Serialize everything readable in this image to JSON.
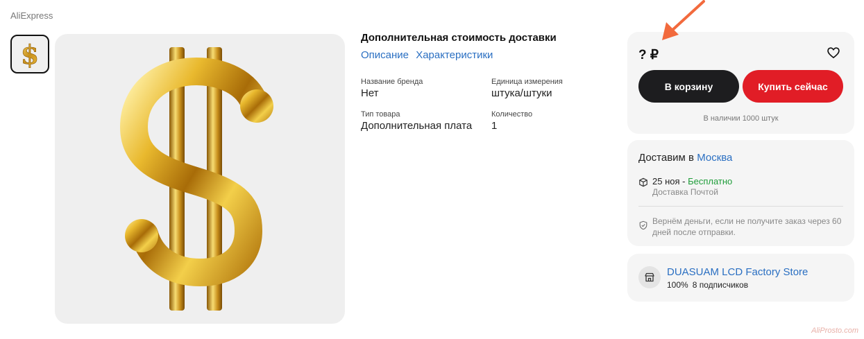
{
  "header": {
    "brand": "AliExpress"
  },
  "gallery": {
    "thumbnail_icon": "dollar-sign-icon",
    "main_image_icon": "gold-dollar-sign-icon"
  },
  "product": {
    "title": "Дополнительная стоимость доставки",
    "links": [
      "Описание",
      "Характеристики"
    ],
    "specs": [
      {
        "label": "Название бренда",
        "value": "Нет"
      },
      {
        "label": "Единица измерения",
        "value": "штука/штуки"
      },
      {
        "label": "Тип товара",
        "value": "Дополнительная плата"
      },
      {
        "label": "Количество",
        "value": "1"
      }
    ]
  },
  "purchase": {
    "price": "? ₽",
    "favorite_icon": "heart-icon",
    "cart_label": "В корзину",
    "buy_label": "Купить сейчас",
    "stock": "В наличии 1000 штук",
    "colors": {
      "cart": "#1d1d1f",
      "buy": "#e11d26"
    }
  },
  "delivery": {
    "prefix": "Доставим в",
    "city": "Москва",
    "date": "25 ноя",
    "separator": " - ",
    "free": "Бесплатно",
    "method": "Доставка Почтой",
    "guarantee": "Вернём деньги, если не получите заказ через 60 дней после отправки."
  },
  "store": {
    "name": "DUASUAM LCD Factory Store",
    "rating": "100%",
    "followers": "8 подписчиков"
  },
  "annotation": {
    "arrow_color": "#f26a3d"
  },
  "watermark": "AliProsto.com"
}
